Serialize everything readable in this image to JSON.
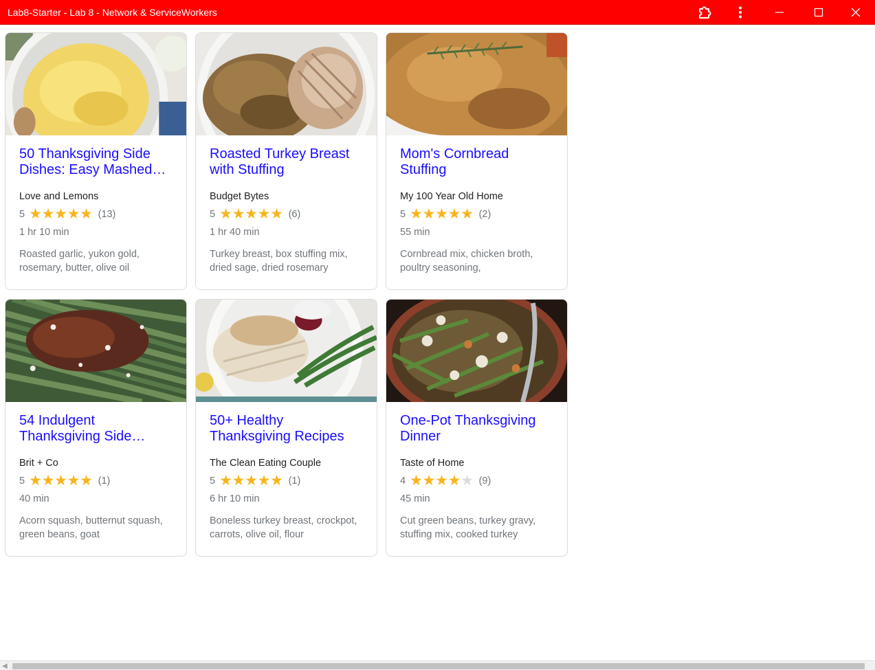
{
  "window": {
    "title": "Lab8-Starter - Lab 8 - Network & ServiceWorkers",
    "titlebar_color": "#ff0000",
    "controls": [
      "extension-icon",
      "more-vert-icon",
      "minimize-icon",
      "maximize-icon",
      "close-icon"
    ]
  },
  "theme": {
    "link_color": "#1a0dff",
    "star_color": "#f8b41c",
    "muted_text": "#70757a"
  },
  "cards": [
    {
      "title": "50 Thanksgiving Side Dishes: Easy Mashed…",
      "source": "Love and Lemons",
      "rating": "5",
      "stars": 5,
      "reviews": "(13)",
      "time": "1 hr 10 min",
      "ingredients": "Roasted garlic, yukon gold, rosemary, butter, olive oil",
      "image_subject": "mashed potatoes"
    },
    {
      "title": "Roasted Turkey Breast with Stuffing",
      "source": "Budget Bytes",
      "rating": "5",
      "stars": 5,
      "reviews": "(6)",
      "time": "1 hr 40 min",
      "ingredients": "Turkey breast, box stuffing mix, dried sage, dried rosemary",
      "image_subject": "turkey with stuffing"
    },
    {
      "title": "Mom's Cornbread Stuffing",
      "source": "My 100 Year Old Home",
      "rating": "5",
      "stars": 5,
      "reviews": "(2)",
      "time": "55 min",
      "ingredients": "Cornbread mix, chicken broth, poultry seasoning,",
      "image_subject": "cornbread stuffing"
    },
    {
      "title": "54 Indulgent Thanksgiving Side…",
      "source": "Brit + Co",
      "rating": "5",
      "stars": 5,
      "reviews": "(1)",
      "time": "40 min",
      "ingredients": "Acorn squash, butternut squash, green beans, goat",
      "image_subject": "green beans with pecans"
    },
    {
      "title": "50+ Healthy Thanksgiving Recipes",
      "source": "The Clean Eating Couple",
      "rating": "5",
      "stars": 5,
      "reviews": "(1)",
      "time": "6 hr 10 min",
      "ingredients": "Boneless turkey breast, crockpot, carrots, olive oil, flour",
      "image_subject": "turkey plate with green beans"
    },
    {
      "title": "One-Pot Thanksgiving Dinner",
      "source": "Taste of Home",
      "rating": "4",
      "stars": 4,
      "reviews": "(9)",
      "time": "45 min",
      "ingredients": "Cut green beans, turkey gravy, stuffing mix, cooked turkey",
      "image_subject": "one-pot casserole"
    }
  ]
}
